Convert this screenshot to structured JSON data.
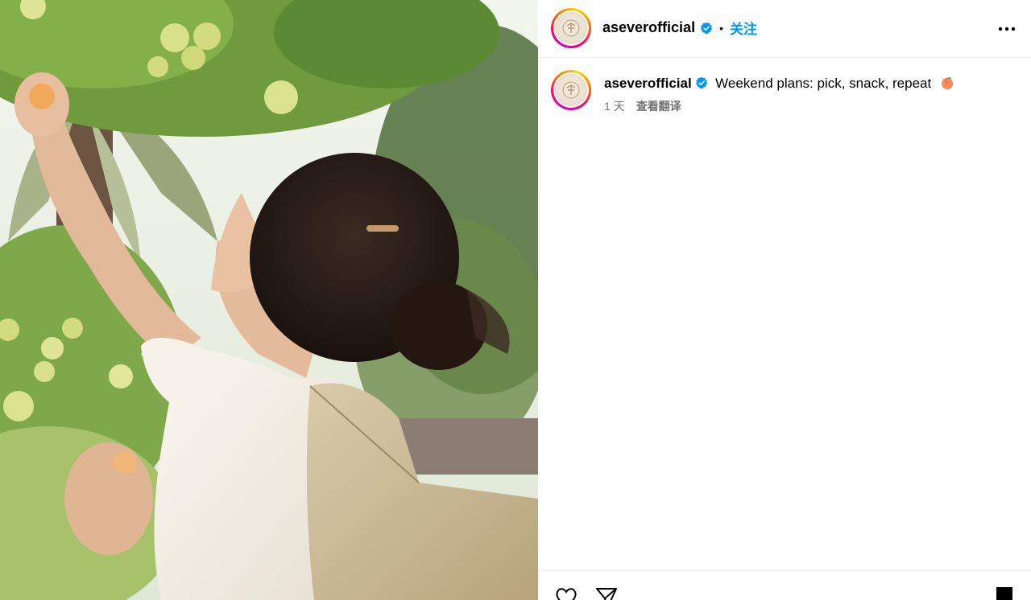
{
  "header": {
    "username": "aseverofficial",
    "separator": "•",
    "follow_label": "关注",
    "more_icon": "more-horizontal-icon",
    "verified_icon": "verified-badge-icon"
  },
  "caption": {
    "username": "aseverofficial",
    "text": "Weekend plans: pick, snack, repeat",
    "emoji_icon": "peach-emoji-icon",
    "time_ago": "1 天",
    "translate_label": "查看翻译"
  },
  "actions": {
    "like_icon": "heart-icon",
    "share_icon": "send-icon",
    "save_icon": "bookmark-icon"
  },
  "colors": {
    "follow_blue": "#0095f6",
    "verified_blue": "#0095f6",
    "meta_gray": "#737373",
    "divider": "#efefef"
  }
}
